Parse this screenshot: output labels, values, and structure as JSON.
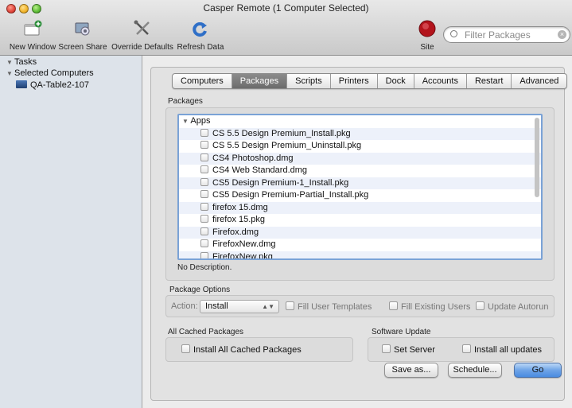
{
  "window": {
    "title": "Casper Remote  (1 Computer Selected)"
  },
  "toolbar": {
    "new_window": "New Window",
    "screen_share": "Screen Share",
    "override_defaults": "Override Defaults",
    "refresh_data": "Refresh Data",
    "site": "Site",
    "filter_placeholder": "Filter Packages"
  },
  "sidebar": {
    "tasks": "Tasks",
    "selected_computers": "Selected Computers",
    "computer": "QA-Table2-107"
  },
  "tabs": [
    "Computers",
    "Packages",
    "Scripts",
    "Printers",
    "Dock",
    "Accounts",
    "Restart",
    "Advanced"
  ],
  "active_tab": "Packages",
  "packages": {
    "label": "Packages",
    "group": "Apps",
    "items": [
      "CS 5.5 Design Premium_Install.pkg",
      "CS 5.5 Design Premium_Uninstall.pkg",
      "CS4 Photoshop.dmg",
      "CS4 Web Standard.dmg",
      "CS5 Design Premium-1_Install.pkg",
      "CS5 Design Premium-Partial_Install.pkg",
      "firefox 15.dmg",
      "firefox 15.pkg",
      "Firefox.dmg",
      "FirefoxNew.dmg",
      "FirefoxNew.pkg"
    ],
    "description": "No Description."
  },
  "package_options": {
    "label": "Package Options",
    "action_label": "Action:",
    "action_value": "Install",
    "fill_user_templates": "Fill User Templates",
    "fill_existing_users": "Fill Existing Users",
    "update_autorun": "Update Autorun"
  },
  "cached": {
    "label": "All Cached Packages",
    "install_all": "Install All Cached Packages"
  },
  "software_update": {
    "label": "Software Update",
    "set_server": "Set Server",
    "install_all_updates": "Install all updates"
  },
  "buttons": {
    "save_as": "Save as...",
    "schedule": "Schedule...",
    "go": "Go"
  }
}
